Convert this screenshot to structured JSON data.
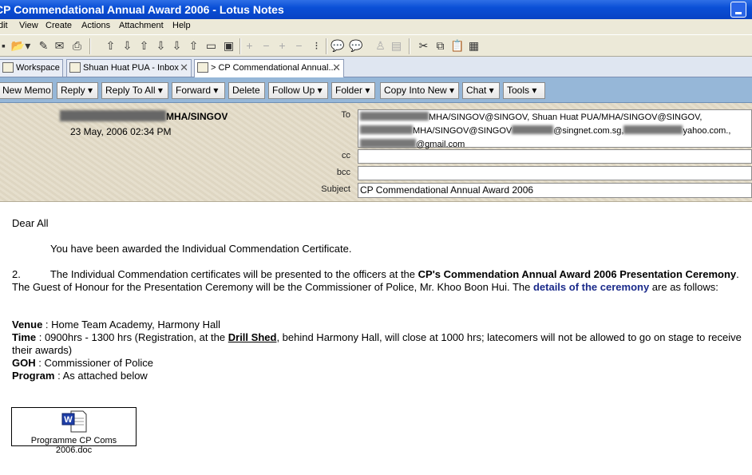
{
  "window": {
    "title": "CP Commendational Annual Award 2006 - Lotus Notes"
  },
  "menu": [
    "dit",
    "View",
    "Create",
    "Actions",
    "Attachment",
    "Help"
  ],
  "tabs": [
    {
      "label": "Workspace"
    },
    {
      "label": "Shuan Huat PUA - Inbox"
    },
    {
      "label": "> CP Commendational Annual..."
    }
  ],
  "actions": {
    "new_memo": "New Memo",
    "reply": "Reply ▾",
    "reply_to_all": "Reply To All ▾",
    "forward": "Forward ▾",
    "delete": "Delete",
    "follow_up": "Follow Up ▾",
    "folder": "Folder ▾",
    "copy_into_new": "Copy Into New ▾",
    "chat": "Chat ▾",
    "tools": "Tools ▾"
  },
  "header": {
    "sender_suffix": "MHA/SINGOV",
    "date": "23 May, 2006 02:34 PM",
    "to_label": "To",
    "cc_label": "cc",
    "bcc_label": "bcc",
    "subject_label": "Subject",
    "to_line1_a": "MHA/SINGOV@SINGOV, Shuan Huat PUA/MHA/SINGOV@SINGOV,",
    "to_line2_a": "MHA/SINGOV@SINGOV",
    "to_line2_b": "@singnet.com.sg,",
    "to_line2_c": "yahoo.com.,",
    "to_line3": "@gmail.com",
    "cc": "",
    "bcc": "",
    "subject": "CP Commendational Annual Award 2006"
  },
  "body": {
    "greeting": "Dear All",
    "para1": "You have been awarded the Individual Commendation Certificate.",
    "para2_num": "2.",
    "para2_a": "The Individual Commendation certificates will be presented to the officers at the ",
    "para2_bold": "CP's Commendation Annual Award 2006 Presentation Ceremony",
    "para2_b": ". The Guest of Honour for the Presentation Ceremony will be the Commissioner of Police, Mr. Khoo Boon Hui. The ",
    "para2_link": "details of the ceremony",
    "para2_c": " are as follows:",
    "venue_label": "Venue",
    "venue": " : Home Team Academy, Harmony Hall",
    "time_label": "Time",
    "time_a": " : 0900hrs - 1300 hrs (Registration, at the ",
    "time_link": "Drill Shed",
    "time_b": ", behind Harmony Hall, will close at 1000 hrs; latecomers will not be allowed to go on stage to receive their awards)",
    "goh_label": "GOH",
    "goh": " : Commissioner of Police",
    "program_label": "Program",
    "program": " : As attached below"
  },
  "attachment": {
    "filename": "Programme CP Coms 2006.doc",
    "icon_letter": "W"
  }
}
